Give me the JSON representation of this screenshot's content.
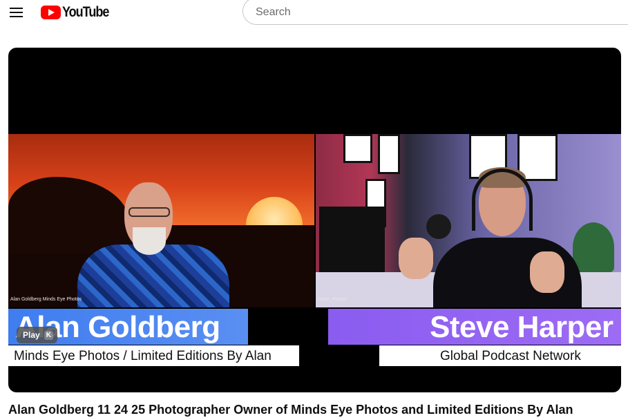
{
  "header": {
    "logo_text": "YouTube",
    "search_placeholder": "Search"
  },
  "video": {
    "left_cam_tag": "Alan Goldberg Minds Eye Photos",
    "right_cam_tag": "Steve_Harper",
    "left_name": "Alan Goldberg",
    "left_subtitle": "Minds Eye Photos / Limited Editions By Alan",
    "right_name": "Steve Harper",
    "right_subtitle": "Global Podcast Network",
    "play_label": "Play",
    "play_shortcut": "K"
  },
  "title": "Alan Goldberg 11 24 25 Photographer Owner of Minds Eye Photos and Limited Editions By Alan",
  "colors": {
    "brand_red": "#ff0000",
    "left_name_bar": "#3f7df0",
    "right_name_bar": "#8a5cf0"
  }
}
